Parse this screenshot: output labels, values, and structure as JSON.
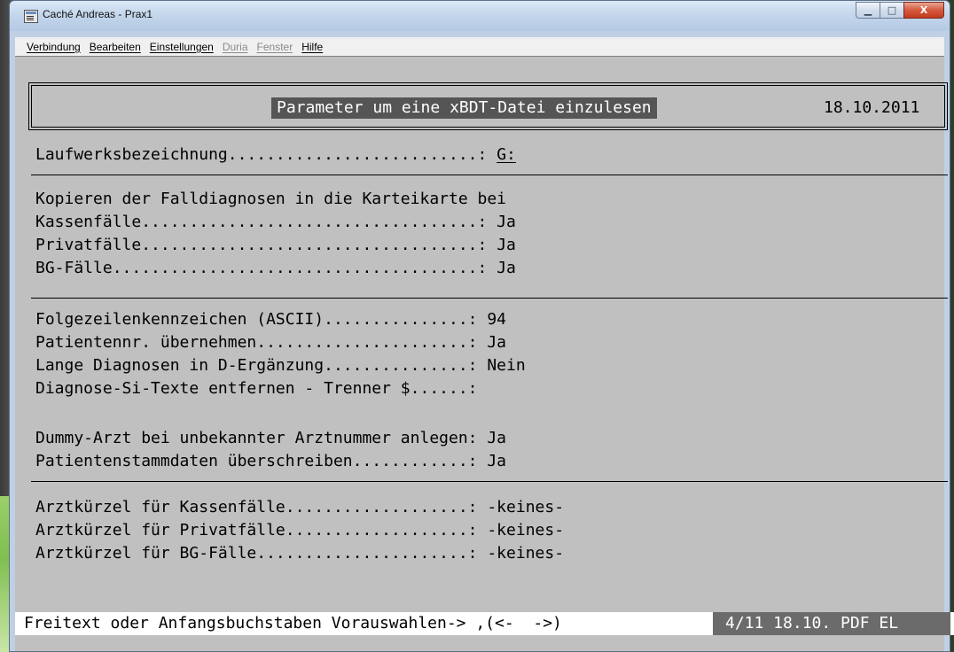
{
  "window": {
    "title": "Caché Andreas - Prax1",
    "min_glyph": "▁",
    "max_glyph": "□",
    "close_glyph": "X"
  },
  "menu": [
    {
      "label": "Verbindung",
      "enabled": true
    },
    {
      "label": "Bearbeiten",
      "enabled": true
    },
    {
      "label": "Einstellungen",
      "enabled": true
    },
    {
      "label": "Duria",
      "enabled": false
    },
    {
      "label": "Fenster",
      "enabled": false
    },
    {
      "label": "Hilfe",
      "enabled": true
    }
  ],
  "header": {
    "title": "Parameter um eine xBDT-Datei einzulesen",
    "date": "18.10.2011"
  },
  "drive": {
    "label": "Laufwerksbezeichnung..........................:",
    "value": "G:"
  },
  "copy_section": {
    "heading": "Kopieren der Falldiagnosen in die Karteikarte bei",
    "rows": [
      {
        "label": "Kassenfälle...................................:",
        "value": "Ja"
      },
      {
        "label": "Privatfälle...................................:",
        "value": "Ja"
      },
      {
        "label": "BG-Fälle......................................:",
        "value": "Ja"
      }
    ]
  },
  "options_section": {
    "rows": [
      {
        "label": "Folgezeilenkennzeichen (ASCII)...............:",
        "value": "94"
      },
      {
        "label": "Patientennr. übernehmen......................:",
        "value": "Ja"
      },
      {
        "label": "Lange Diagnosen in D-Ergänzung...............:",
        "value": "Nein"
      },
      {
        "label": "Diagnose-Si-Texte entfernen - Trenner $......:",
        "value": ""
      },
      {
        "label": "Dummy-Arzt bei unbekannter Arztnummer anlegen:",
        "value": "Ja"
      },
      {
        "label": "Patientenstammdaten überschreiben............:",
        "value": "Ja"
      }
    ]
  },
  "doctor_section": {
    "rows": [
      {
        "label": "Arztkürzel für Kassenfälle...................:",
        "value": "-keines-"
      },
      {
        "label": "Arztkürzel für Privatfälle...................:",
        "value": "-keines-"
      },
      {
        "label": "Arztkürzel für BG-Fälle......................:",
        "value": "-keines-"
      }
    ]
  },
  "status": {
    "prompt": "Freitext oder Anfangsbuchstaben Vorauswahlen-> ,(<-  ->)",
    "info": "4/11 18.10. PDF EL"
  }
}
